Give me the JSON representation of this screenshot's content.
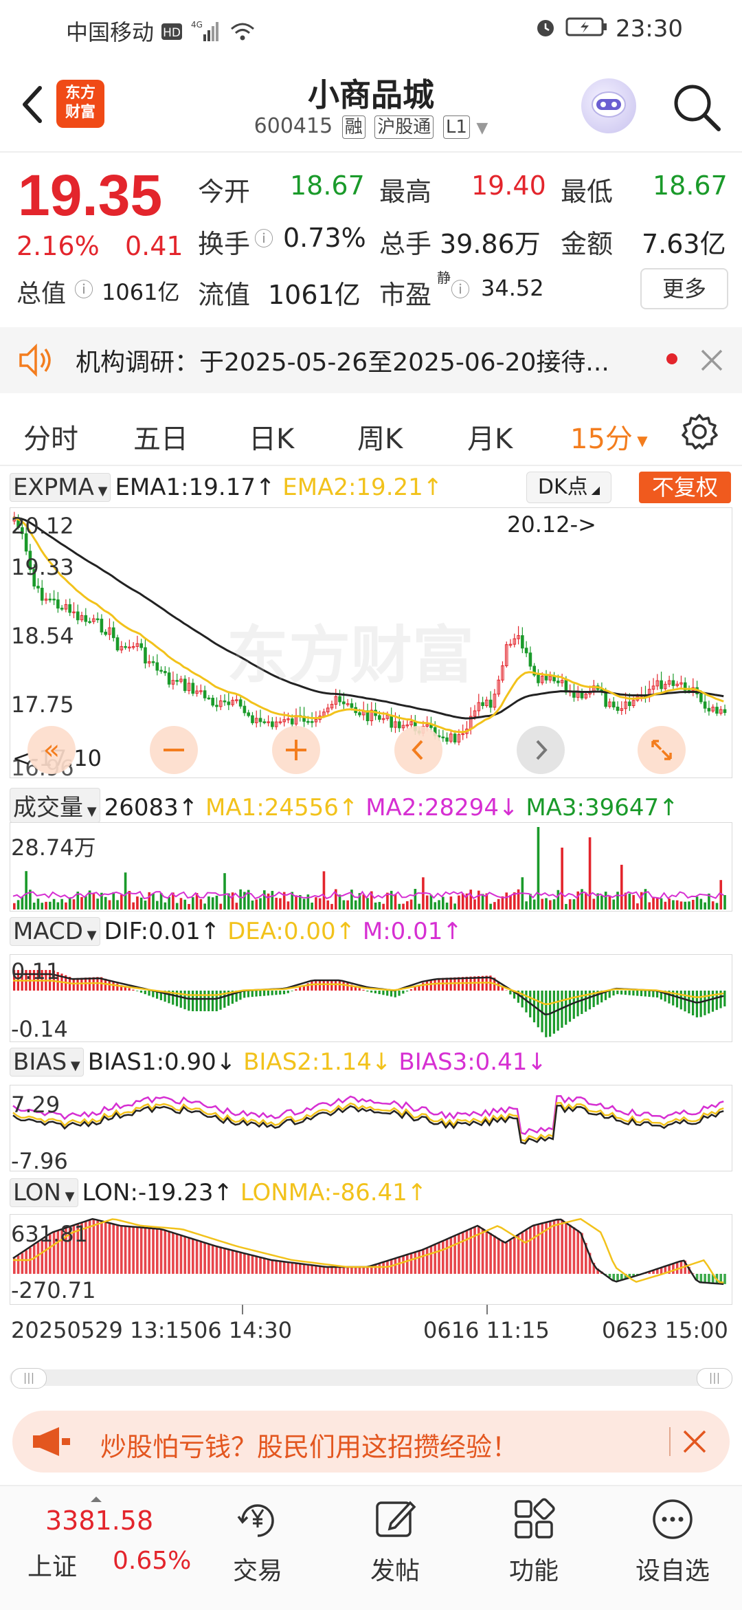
{
  "status_bar": {
    "carrier": "中国移动",
    "time": "23:30"
  },
  "header": {
    "title": "小商品城",
    "code": "600415",
    "tag1": "融",
    "tag2": "沪股通",
    "tag3": "L1",
    "logo_text": "东方\n财富"
  },
  "quote": {
    "price": "19.35",
    "change_pct": "2.16%",
    "change_abs": "0.41",
    "open_label": "今开",
    "open": "18.67",
    "high_label": "最高",
    "high": "19.40",
    "low_label": "最低",
    "low": "18.67",
    "turnover_label": "换手",
    "turnover": "0.73%",
    "volume_label": "总手",
    "volume": "39.86万",
    "amount_label": "金额",
    "amount": "7.63亿",
    "mktcap_label": "总值",
    "mktcap": "1061亿",
    "float_label": "流值",
    "float": "1061亿",
    "pe_label": "市盈",
    "pe_sup": "静",
    "pe": "34.52",
    "more": "更多"
  },
  "notice": {
    "text": "机构调研：于2025-05-26至2025-06-20接待..."
  },
  "tabs": [
    {
      "label": "分时"
    },
    {
      "label": "五日"
    },
    {
      "label": "日K"
    },
    {
      "label": "周K"
    },
    {
      "label": "月K"
    },
    {
      "label": "15分"
    }
  ],
  "chart": {
    "main_indicator": "EXPMA",
    "ema1": "EMA1:19.17↑",
    "ema2": "EMA2:19.21↑",
    "dk_btn": "DK点",
    "fq_btn": "不复权",
    "y_labels": [
      "20.12",
      "19.33",
      "18.54",
      "17.75",
      "16.96"
    ],
    "max_marker": "20.12->",
    "min_marker": "<-17.10",
    "watermark": "东方财富",
    "vol_indicator": "成交量",
    "vol": "26083↑",
    "vol_ma1": "MA1:24556↑",
    "vol_ma2": "MA2:28294↓",
    "vol_ma3": "MA3:39647↑",
    "vol_max": "28.74万",
    "macd_indicator": "MACD",
    "dif": "DIF:0.01↑",
    "dea": "DEA:0.00↑",
    "m": "M:0.01↑",
    "macd_top": "0.11",
    "macd_bot": "-0.14",
    "bias_indicator": "BIAS",
    "bias1": "BIAS1:0.90↓",
    "bias2": "BIAS2:1.14↓",
    "bias3": "BIAS3:0.41↓",
    "bias_top": "7.29",
    "bias_bot": "-7.96",
    "lon_indicator": "LON",
    "lon": "LON:-19.23↑",
    "lonma": "LONMA:-86.41↑",
    "lon_top": "631.81",
    "lon_bot": "-270.71",
    "time_labels": [
      "20250529 13:15",
      "06 14:30",
      "0616 11:15",
      "0623 15:00"
    ],
    "colors": {
      "up": "#e3252c",
      "down": "#1a9a2a",
      "ema1": "#222222",
      "ema2": "#f2c21b",
      "ma2": "#d62fd2"
    }
  },
  "ad": {
    "text": "炒股怕亏钱？股民们用这招攒经验！"
  },
  "nav": {
    "index_value": "3381.58",
    "index_name": "上证",
    "index_pct": "0.65%",
    "items": [
      {
        "label": "交易"
      },
      {
        "label": "发帖"
      },
      {
        "label": "功能"
      },
      {
        "label": "设自选"
      }
    ]
  }
}
